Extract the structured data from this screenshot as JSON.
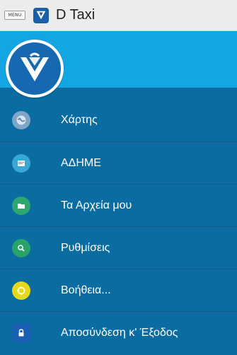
{
  "actionbar": {
    "menu_label": "MENU",
    "title": "D Taxi",
    "logo_icon": "dtaxi-logo-icon"
  },
  "drawer": {
    "avatar_icon": "dtaxi-logo-icon",
    "header_color": "#14a6e2",
    "background_color": "#0a6ca0",
    "items": [
      {
        "label": "Χάρτης",
        "icon": "globe-icon",
        "icon_color": "#7fa6c7"
      },
      {
        "label": "ΑΔΗΜΕ",
        "icon": "document-icon",
        "icon_color": "#3aa7d9"
      },
      {
        "label": "Τα Αρχεία μου",
        "icon": "folder-icon",
        "icon_color": "#2ea66f"
      },
      {
        "label": "Ρυθμίσεις",
        "icon": "search-settings-icon",
        "icon_color": "#28a36a"
      },
      {
        "label": "Βοήθεια...",
        "icon": "help-icon",
        "icon_color": "#e7d91a"
      },
      {
        "label": "Αποσύνδεση κ' Έξοδος",
        "icon": "lock-icon",
        "icon_color": "#1b5fb5"
      }
    ]
  }
}
